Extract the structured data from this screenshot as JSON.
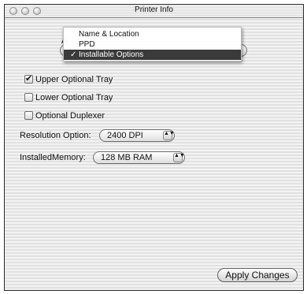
{
  "window": {
    "title": "Printer Info"
  },
  "popup": {
    "trigger_letter": "A",
    "items": [
      {
        "label": "Name & Location",
        "selected": false
      },
      {
        "label": "PPD",
        "selected": false
      },
      {
        "label": "Installable Options",
        "selected": true
      }
    ]
  },
  "options": {
    "upper_tray": {
      "label": "Upper Optional Tray",
      "checked": true,
      "mark": "✔"
    },
    "lower_tray": {
      "label": "Lower Optional Tray",
      "checked": false,
      "mark": ""
    },
    "duplexer": {
      "label": "Optional Duplexer",
      "checked": false,
      "mark": ""
    },
    "resolution": {
      "label": "Resolution Option:",
      "value": "2400 DPI"
    },
    "memory": {
      "label": "InstalledMemory:",
      "value": "128 MB RAM"
    }
  },
  "buttons": {
    "apply_label": "Apply Changes"
  },
  "menu_check": "✓",
  "updown_glyph": "▲▼"
}
